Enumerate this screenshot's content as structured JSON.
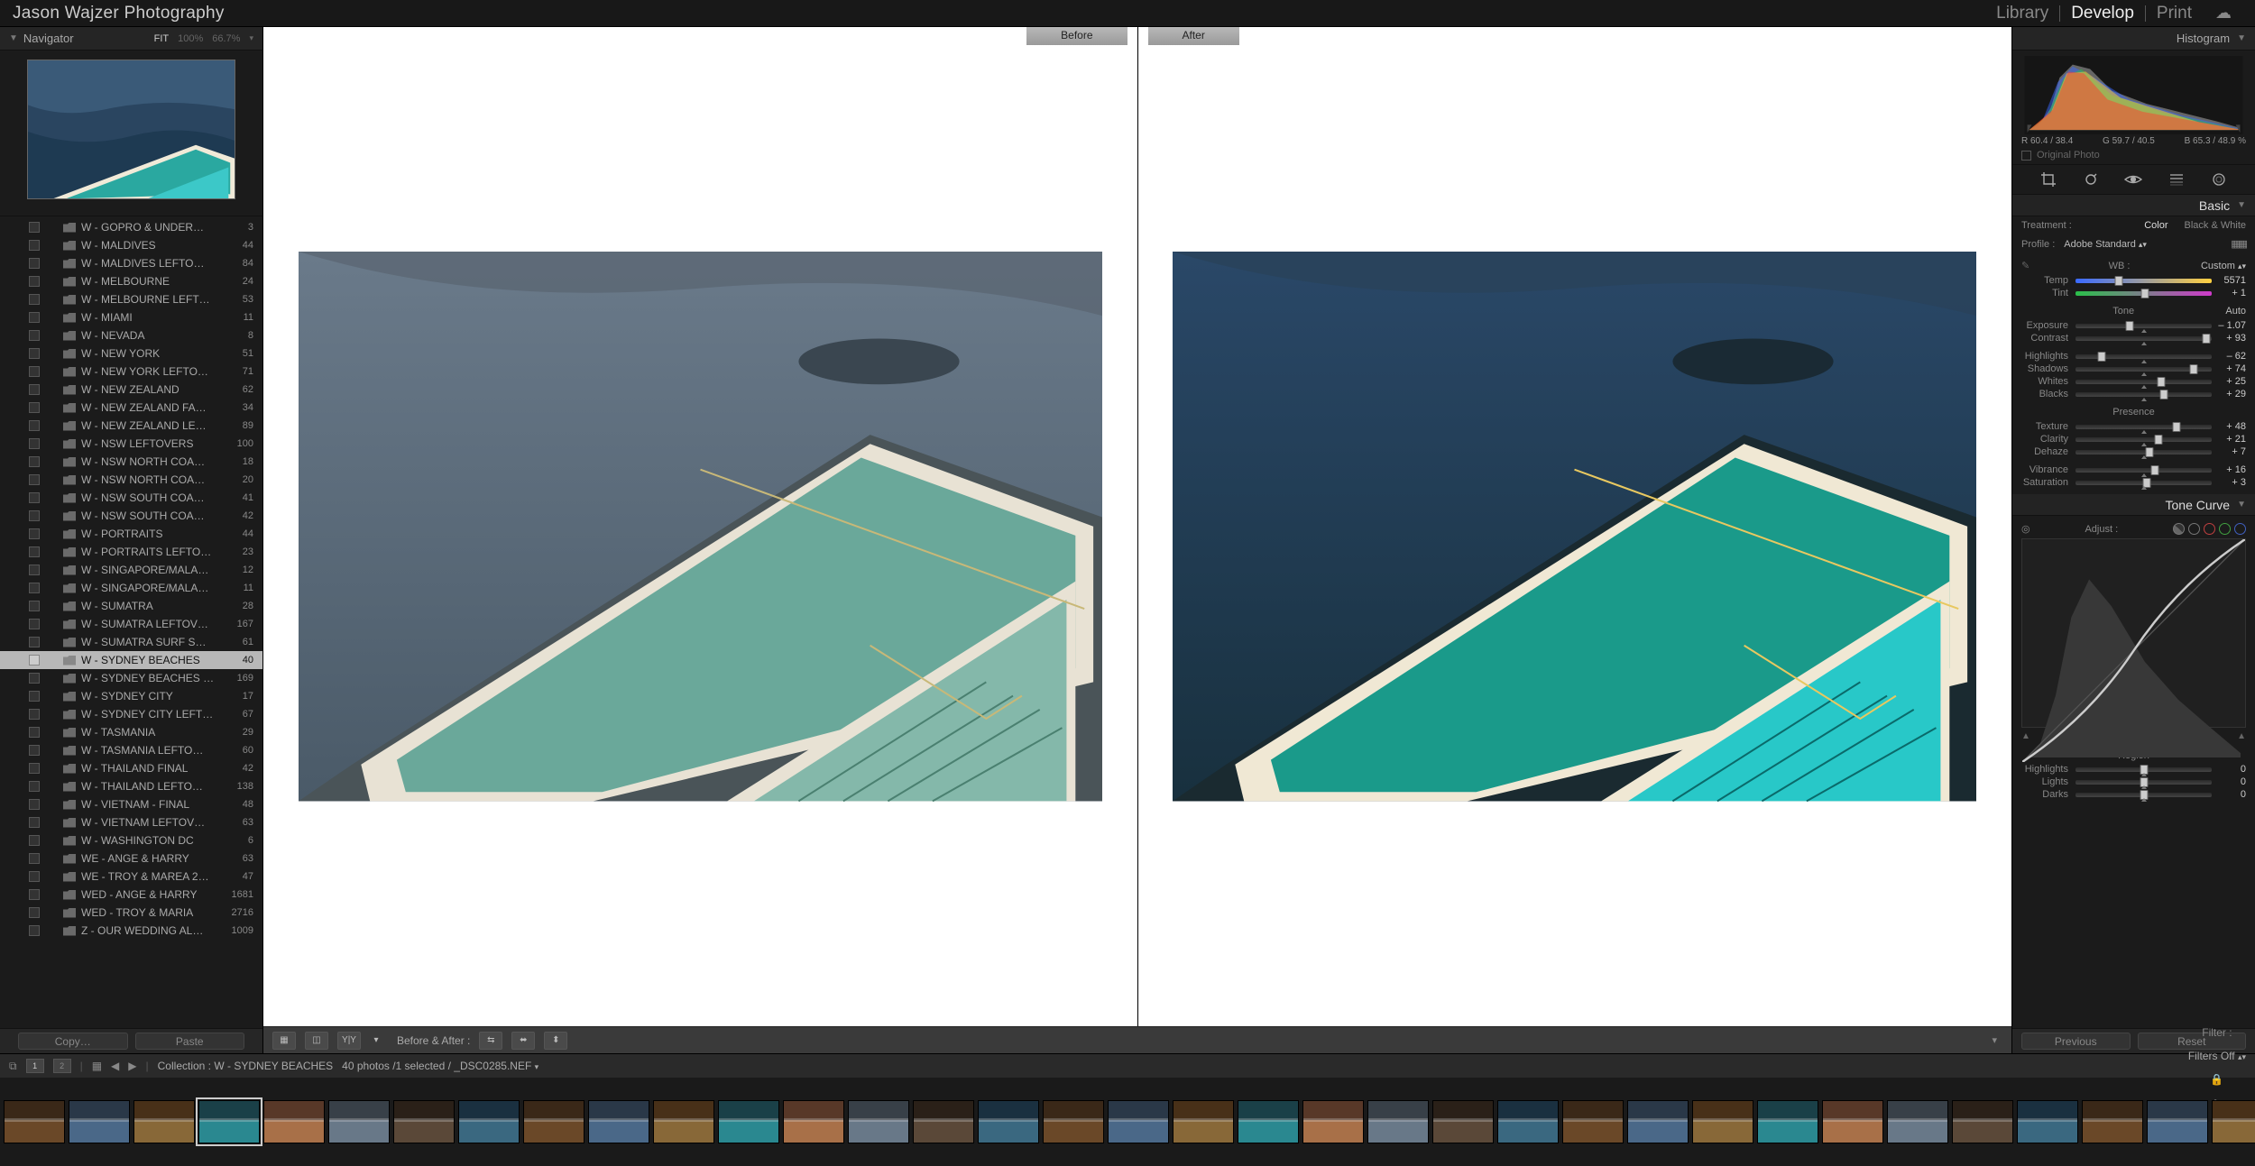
{
  "app_title": "Jason Wajzer Photography",
  "top_nav": {
    "library": "Library",
    "develop": "Develop",
    "print": "Print"
  },
  "navigator": {
    "title": "Navigator",
    "modes": {
      "fit": "FIT",
      "hundred": "100%",
      "custom": "66.7%"
    }
  },
  "folders": [
    {
      "name": "W - GOPRO & UNDER…",
      "count": "3"
    },
    {
      "name": "W - MALDIVES",
      "count": "44"
    },
    {
      "name": "W - MALDIVES LEFTO…",
      "count": "84"
    },
    {
      "name": "W - MELBOURNE",
      "count": "24"
    },
    {
      "name": "W - MELBOURNE LEFT…",
      "count": "53"
    },
    {
      "name": "W - MIAMI",
      "count": "11"
    },
    {
      "name": "W - NEVADA",
      "count": "8"
    },
    {
      "name": "W - NEW YORK",
      "count": "51"
    },
    {
      "name": "W - NEW YORK LEFTO…",
      "count": "71"
    },
    {
      "name": "W - NEW ZEALAND",
      "count": "62"
    },
    {
      "name": "W - NEW ZEALAND FA…",
      "count": "34"
    },
    {
      "name": "W - NEW ZEALAND LE…",
      "count": "89"
    },
    {
      "name": "W - NSW LEFTOVERS",
      "count": "100"
    },
    {
      "name": "W - NSW NORTH COA…",
      "count": "18"
    },
    {
      "name": "W - NSW NORTH COA…",
      "count": "20"
    },
    {
      "name": "W - NSW SOUTH COA…",
      "count": "41"
    },
    {
      "name": "W - NSW SOUTH COA…",
      "count": "42"
    },
    {
      "name": "W - PORTRAITS",
      "count": "44"
    },
    {
      "name": "W - PORTRAITS LEFTO…",
      "count": "23"
    },
    {
      "name": "W - SINGAPORE/MALA…",
      "count": "12"
    },
    {
      "name": "W - SINGAPORE/MALA…",
      "count": "11"
    },
    {
      "name": "W - SUMATRA",
      "count": "28"
    },
    {
      "name": "W - SUMATRA LEFTOV…",
      "count": "167"
    },
    {
      "name": "W - SUMATRA SURF S…",
      "count": "61"
    },
    {
      "name": "W - SYDNEY BEACHES",
      "count": "40",
      "selected": true
    },
    {
      "name": "W - SYDNEY BEACHES …",
      "count": "169"
    },
    {
      "name": "W - SYDNEY CITY",
      "count": "17"
    },
    {
      "name": "W - SYDNEY CITY LEFT…",
      "count": "67"
    },
    {
      "name": "W - TASMANIA",
      "count": "29"
    },
    {
      "name": "W - TASMANIA LEFTO…",
      "count": "60"
    },
    {
      "name": "W - THAILAND FINAL",
      "count": "42"
    },
    {
      "name": "W - THAILAND LEFTO…",
      "count": "138"
    },
    {
      "name": "W - VIETNAM - FINAL",
      "count": "48"
    },
    {
      "name": "W - VIETNAM LEFTOV…",
      "count": "63"
    },
    {
      "name": "W - WASHINGTON DC",
      "count": "6"
    },
    {
      "name": "WE - ANGE & HARRY",
      "count": "63"
    },
    {
      "name": "WE - TROY & MAREA 2…",
      "count": "47"
    },
    {
      "name": "WED - ANGE & HARRY",
      "count": "1681"
    },
    {
      "name": "WED - TROY & MARIA",
      "count": "2716"
    },
    {
      "name": "Z - OUR WEDDING AL…",
      "count": "1009"
    }
  ],
  "left_buttons": {
    "copy": "Copy…",
    "paste": "Paste"
  },
  "compare": {
    "before": "Before",
    "after": "After",
    "toolbar_label": "Before & After :"
  },
  "histogram": {
    "title": "Histogram",
    "info": {
      "r": "R 60.4 / 38.4",
      "g": "G 59.7 / 40.5",
      "b": "B 65.3 / 48.9 %"
    },
    "original": "Original Photo"
  },
  "basic": {
    "title": "Basic",
    "treatment": {
      "label": "Treatment :",
      "color": "Color",
      "bw": "Black & White"
    },
    "profile": {
      "label": "Profile :",
      "value": "Adobe Standard"
    },
    "wb": {
      "label": "WB :",
      "value": "Custom"
    },
    "sliders_wb": [
      {
        "name": "Temp",
        "value": "5571",
        "pos": 32
      },
      {
        "name": "Tint",
        "value": "+ 1",
        "pos": 51
      }
    ],
    "tone": {
      "label": "Tone",
      "auto": "Auto"
    },
    "sliders_tone": [
      {
        "name": "Exposure",
        "value": "– 1.07",
        "pos": 40
      },
      {
        "name": "Contrast",
        "value": "+ 93",
        "pos": 96
      }
    ],
    "sliders_tone2": [
      {
        "name": "Highlights",
        "value": "– 62",
        "pos": 19
      },
      {
        "name": "Shadows",
        "value": "+ 74",
        "pos": 87
      },
      {
        "name": "Whites",
        "value": "+ 25",
        "pos": 63
      },
      {
        "name": "Blacks",
        "value": "+ 29",
        "pos": 65
      }
    ],
    "presence": {
      "label": "Presence"
    },
    "sliders_presence": [
      {
        "name": "Texture",
        "value": "+ 48",
        "pos": 74
      },
      {
        "name": "Clarity",
        "value": "+ 21",
        "pos": 61
      },
      {
        "name": "Dehaze",
        "value": "+ 7",
        "pos": 54
      }
    ],
    "sliders_presence2": [
      {
        "name": "Vibrance",
        "value": "+ 16",
        "pos": 58
      },
      {
        "name": "Saturation",
        "value": "+ 3",
        "pos": 52
      }
    ]
  },
  "tonecurve": {
    "title": "Tone Curve",
    "adjust": "Adjust :",
    "region": "Region",
    "sliders": [
      {
        "name": "Highlights",
        "value": "0",
        "pos": 50
      },
      {
        "name": "Lights",
        "value": "0",
        "pos": 50
      },
      {
        "name": "Darks",
        "value": "0",
        "pos": 50
      }
    ]
  },
  "right_buttons": {
    "prev": "Previous",
    "reset": "Reset"
  },
  "filmstrip_bar": {
    "collection_label": "Collection :",
    "collection": "W - SYDNEY BEACHES",
    "count": "40 photos /1 selected /",
    "file": "_DSC0285.NEF",
    "filter": "Filter :",
    "filters_off": "Filters Off"
  },
  "thumbs": 35
}
